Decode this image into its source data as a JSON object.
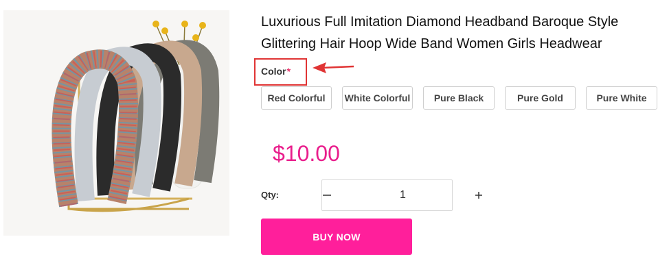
{
  "product": {
    "title_line1": "Luxurious Full Imitation Diamond Headband Baroque Style",
    "title_line2": "Glittering Hair Hoop Wide Band Women Girls Headwear",
    "price": "$10.00"
  },
  "color": {
    "label": "Color",
    "required_mark": "*",
    "options": [
      "Red Colorful",
      "White Colorful",
      "Pure Black",
      "Pure Gold",
      "Pure White"
    ]
  },
  "quantity": {
    "label": "Qty:",
    "value": "1",
    "decrement_icon": "minus-icon",
    "increment_icon": "plus-icon"
  },
  "actions": {
    "buy_now": "BUY NOW"
  },
  "colors": {
    "accent": "#ff1f9b",
    "price": "#e91e8c",
    "annotation": "#e03434"
  }
}
